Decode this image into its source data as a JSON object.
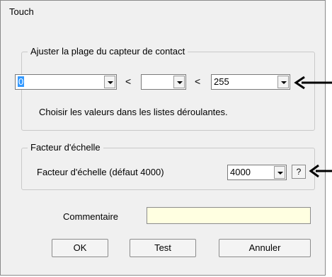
{
  "window": {
    "title": "Touch"
  },
  "range_group": {
    "legend": "Ajuster la plage du capteur de contact",
    "min_value": "0",
    "mid_value": "",
    "max_value": "255",
    "less_than_1": "<",
    "less_than_2": "<",
    "hint": "Choisir les valeurs dans les listes déroulantes."
  },
  "scale_group": {
    "legend": "Facteur d'échelle",
    "label": "Facteur d'échelle (défaut 4000)",
    "value": "4000",
    "help_label": "?"
  },
  "comment": {
    "label": "Commentaire",
    "value": ""
  },
  "buttons": {
    "ok": "OK",
    "test": "Test",
    "cancel": "Annuler"
  }
}
